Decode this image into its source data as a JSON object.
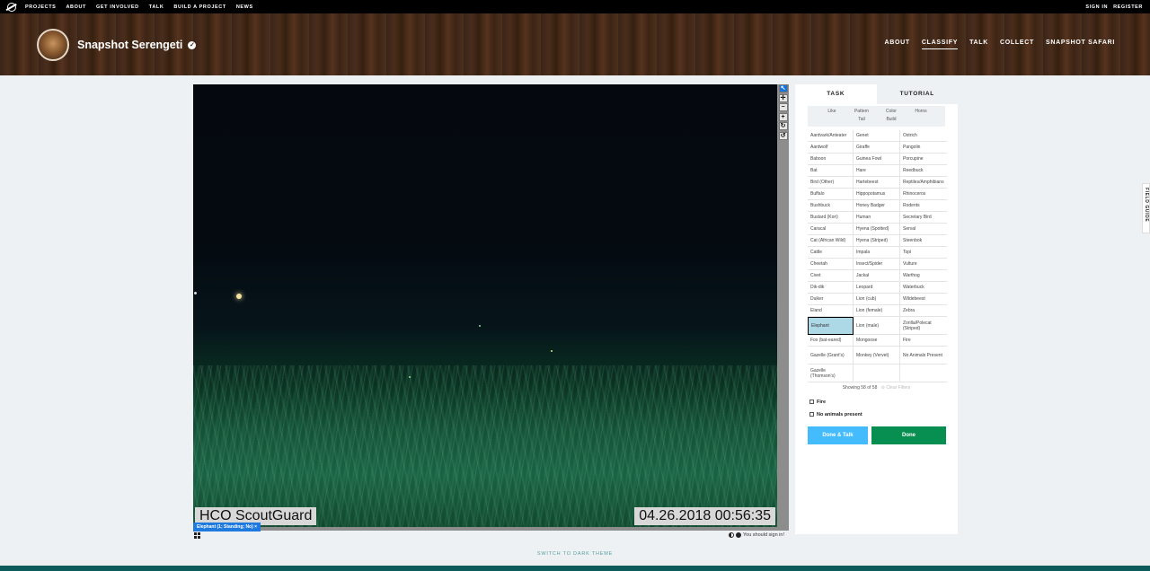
{
  "zoo_nav": {
    "links": [
      "PROJECTS",
      "ABOUT",
      "GET INVOLVED",
      "TALK",
      "BUILD A PROJECT",
      "NEWS"
    ],
    "sign_in": "SIGN IN",
    "register": "REGISTER"
  },
  "project": {
    "title": "Snapshot Serengeti",
    "nav": [
      "ABOUT",
      "CLASSIFY",
      "TALK",
      "COLLECT",
      "SNAPSHOT SAFARI"
    ],
    "active_nav": "CLASSIFY"
  },
  "viewer": {
    "stamp_left": "HCO ScoutGuard",
    "stamp_right": "04.26.2018 00:56:35",
    "annotation": "Elephant (1; Standing; No)  ×",
    "tools": [
      "↖",
      "✛",
      "−",
      "+",
      "↻",
      "↺"
    ],
    "sign_in_note": "You should sign in!"
  },
  "task_panel": {
    "tabs": [
      "TASK",
      "TUTORIAL"
    ],
    "filters": [
      "Like",
      "Pattern",
      "Color",
      "Horns",
      "Tail",
      "Build"
    ],
    "species": [
      "Aardvark/Anteater",
      "Genet",
      "Ostrich",
      "Aardwolf",
      "Giraffe",
      "Pangolin",
      "Baboon",
      "Guinea Fowl",
      "Porcupine",
      "Bat",
      "Hare",
      "Reedbuck",
      "Bird (Other)",
      "Hartebeest",
      "Reptiles/Amphibians",
      "Buffalo",
      "Hippopotamus",
      "Rhinoceros",
      "Bushbuck",
      "Honey Badger",
      "Rodents",
      "Bustard (Kori)",
      "Human",
      "Secretary Bird",
      "Caracal",
      "Hyena (Spotted)",
      "Serval",
      "Cat (African Wild)",
      "Hyena (Striped)",
      "Steenbok",
      "Cattle",
      "Impala",
      "Topi",
      "Cheetah",
      "Insect/Spider",
      "Vulture",
      "Civet",
      "Jackal",
      "Warthog",
      "Dik-dik",
      "Leopard",
      "Waterbuck",
      "Duiker",
      "Lion (cub)",
      "Wildebeest",
      "Eland",
      "Lion (female)",
      "Zebra",
      "Elephant",
      "Lion (male)",
      "Zorilla/Polecat (Striped)",
      "Fox (bat-eared)",
      "Mongoose",
      "Fire",
      "Gazelle (Grant's)",
      "Monkey (Vervet)",
      "No Animals Present",
      "Gazelle (Thomson's)",
      "",
      ""
    ],
    "selected": "Elephant",
    "showing": "Showing 58 of 58",
    "clear_filters": "Clear Filters",
    "checkbox_fire": "Fire",
    "checkbox_no_animals": "No animals present",
    "btn_done_talk": "Done & Talk",
    "btn_done": "Done"
  },
  "field_guide": "FIELD GUIDE",
  "theme_switch": "SWITCH TO DARK THEME",
  "colors": {
    "done": "#078f52",
    "done_talk": "#43bbfd",
    "selected": "#add8e6",
    "tool_active": "#1a73d9"
  }
}
